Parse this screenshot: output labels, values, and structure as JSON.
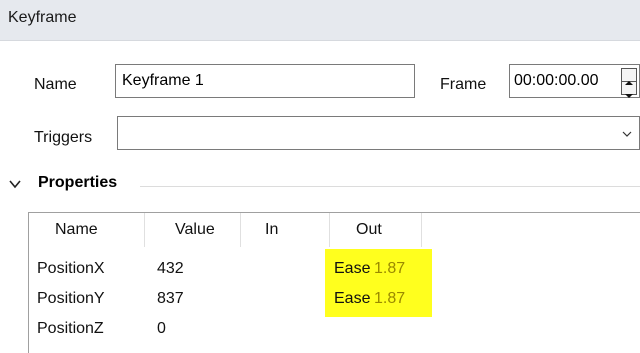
{
  "window": {
    "title": "Keyframe"
  },
  "form": {
    "name_label": "Name",
    "name_value": "Keyframe 1",
    "frame_label": "Frame",
    "frame_value": "00:00:00.00",
    "triggers_label": "Triggers",
    "triggers_value": ""
  },
  "properties": {
    "header": "Properties",
    "columns": [
      "Name",
      "Value",
      "In",
      "Out"
    ],
    "rows": [
      {
        "name": "PositionX",
        "value": "432",
        "in": "",
        "out_mode": "Ease",
        "out_value": "1.87"
      },
      {
        "name": "PositionY",
        "value": "837",
        "in": "",
        "out_mode": "Ease",
        "out_value": "1.87"
      },
      {
        "name": "PositionZ",
        "value": "0",
        "in": "",
        "out_mode": "",
        "out_value": ""
      }
    ]
  },
  "colors": {
    "highlight": "#ffff1e",
    "ease_value": "#9a8a00",
    "titlebar_bg": "#e6e9ee"
  },
  "icons": [
    "chevron-down-icon",
    "spinner-up-icon",
    "spinner-down-icon",
    "collapse-chevron-icon"
  ]
}
